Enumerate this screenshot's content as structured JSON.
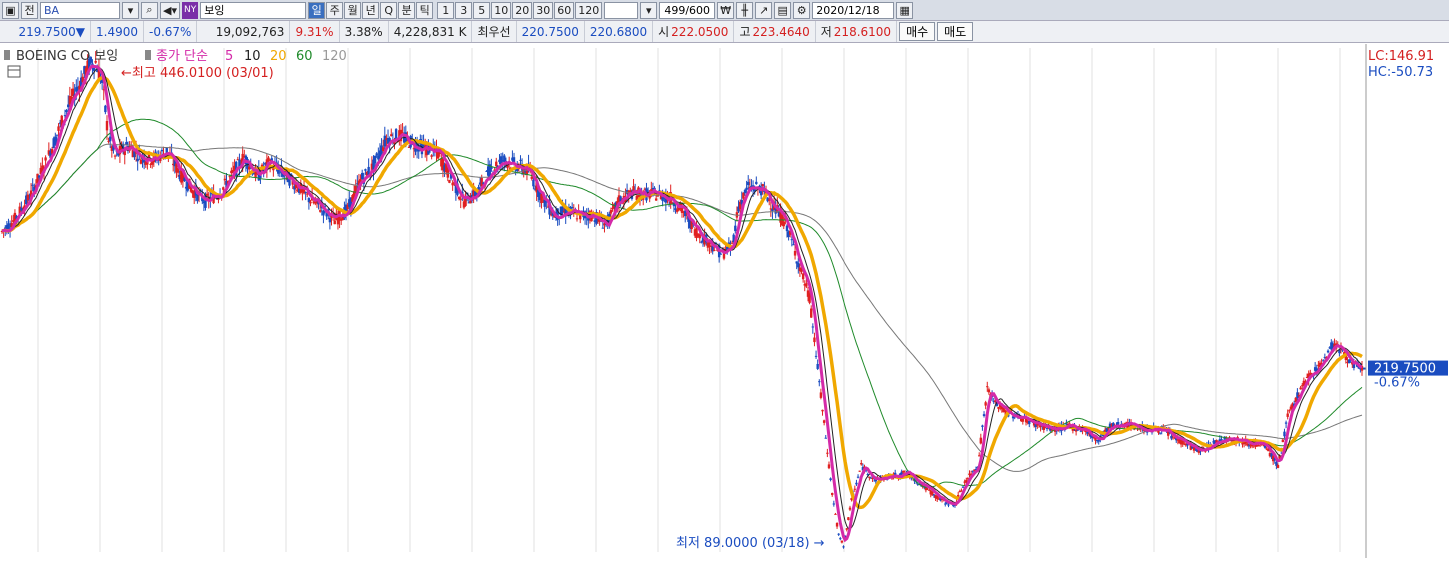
{
  "toolbar": {
    "code": "BA",
    "exchange_badge": "NY",
    "name": "보잉",
    "periods": [
      "일",
      "주",
      "월",
      "년",
      "Q",
      "분",
      "틱"
    ],
    "active_period": "일",
    "minutes": [
      "1",
      "3",
      "5",
      "10",
      "20",
      "30",
      "60",
      "120"
    ],
    "count": "499/600",
    "date": "2020/12/18",
    "label_prev": "전"
  },
  "quote": {
    "price": "219.7500▼",
    "change": "1.4900",
    "change_pct": "-0.67%",
    "volume": "19,092,763",
    "vol_pct": "9.31%",
    "vol_pct2": "3.38%",
    "amount": "4,228,831 K",
    "bid_label": "최우선",
    "bid1": "220.7500",
    "bid2": "220.6800",
    "open_label": "시",
    "open": "222.0500",
    "high_label": "고",
    "high": "223.4640",
    "low_label": "저",
    "low": "218.6100",
    "buy_label": "매수",
    "sell_label": "매도"
  },
  "legend": {
    "name": "BOEING CO  보잉",
    "ma_label": "종가 단순",
    "ma_periods": [
      "5",
      "10",
      "20",
      "60",
      "120"
    ]
  },
  "colors": {
    "up": "#e02020",
    "down": "#1a4cc0",
    "ma5": "#d42aa8",
    "ma10": "#222222",
    "ma20": "#f0a800",
    "ma60": "#1f8a2a",
    "ma120": "#777777",
    "grid": "#d0d0d0",
    "price_tag": "#1a4cc0"
  },
  "chart_data": {
    "type": "candlestick",
    "ylim": [
      88,
      450
    ],
    "yticks": [
      "100,0000",
      "125,0000",
      "150,0000",
      "175,0000",
      "200,0000",
      "225,0000",
      "250,0000",
      "275,0000",
      "300,0000",
      "325,0000",
      "350,0000",
      "375,0000",
      "400,0000",
      "425,0000"
    ],
    "last_price": "219.7500",
    "last_change": "-0.67%",
    "lc": "LC:146.91",
    "hc": "HC:-50.73",
    "high_annotation": "←최고 446.0100 (03/01)",
    "low_annotation": "최저 89.0000 (03/18) →",
    "anchors": [
      [
        0,
        318
      ],
      [
        8,
        327
      ],
      [
        18,
        345
      ],
      [
        28,
        370
      ],
      [
        38,
        400
      ],
      [
        46,
        420
      ],
      [
        54,
        438
      ],
      [
        58,
        440
      ],
      [
        62,
        425
      ],
      [
        66,
        385
      ],
      [
        70,
        372
      ],
      [
        78,
        380
      ],
      [
        86,
        372
      ],
      [
        94,
        370
      ],
      [
        102,
        376
      ],
      [
        110,
        360
      ],
      [
        118,
        348
      ],
      [
        126,
        340
      ],
      [
        134,
        345
      ],
      [
        142,
        358
      ],
      [
        150,
        372
      ],
      [
        158,
        358
      ],
      [
        166,
        368
      ],
      [
        174,
        360
      ],
      [
        182,
        352
      ],
      [
        190,
        342
      ],
      [
        198,
        335
      ],
      [
        206,
        326
      ],
      [
        214,
        334
      ],
      [
        222,
        355
      ],
      [
        230,
        365
      ],
      [
        238,
        385
      ],
      [
        246,
        387
      ],
      [
        254,
        382
      ],
      [
        262,
        378
      ],
      [
        270,
        374
      ],
      [
        278,
        356
      ],
      [
        286,
        340
      ],
      [
        294,
        346
      ],
      [
        302,
        362
      ],
      [
        310,
        370
      ],
      [
        318,
        366
      ],
      [
        326,
        362
      ],
      [
        334,
        343
      ],
      [
        342,
        330
      ],
      [
        350,
        333
      ],
      [
        358,
        330
      ],
      [
        366,
        330
      ],
      [
        374,
        323
      ],
      [
        382,
        340
      ],
      [
        390,
        346
      ],
      [
        398,
        345
      ],
      [
        406,
        345
      ],
      [
        414,
        342
      ],
      [
        422,
        332
      ],
      [
        430,
        318
      ],
      [
        438,
        310
      ],
      [
        446,
        302
      ],
      [
        452,
        308
      ],
      [
        456,
        336
      ],
      [
        462,
        350
      ],
      [
        470,
        349
      ],
      [
        478,
        336
      ],
      [
        486,
        322
      ],
      [
        494,
        292
      ],
      [
        500,
        270
      ],
      [
        506,
        210
      ],
      [
        510,
        170
      ],
      [
        514,
        130
      ],
      [
        518,
        100
      ],
      [
        521,
        92
      ],
      [
        526,
        125
      ],
      [
        532,
        150
      ],
      [
        540,
        140
      ],
      [
        550,
        142
      ],
      [
        560,
        145
      ],
      [
        570,
        136
      ],
      [
        578,
        128
      ],
      [
        584,
        124
      ],
      [
        590,
        122
      ],
      [
        596,
        138
      ],
      [
        604,
        150
      ],
      [
        610,
        205
      ],
      [
        615,
        195
      ],
      [
        622,
        188
      ],
      [
        630,
        185
      ],
      [
        640,
        180
      ],
      [
        650,
        176
      ],
      [
        660,
        178
      ],
      [
        670,
        176
      ],
      [
        678,
        168
      ],
      [
        686,
        178
      ],
      [
        694,
        180
      ],
      [
        702,
        178
      ],
      [
        710,
        176
      ],
      [
        718,
        176
      ],
      [
        726,
        170
      ],
      [
        734,
        165
      ],
      [
        742,
        160
      ],
      [
        750,
        166
      ],
      [
        758,
        170
      ],
      [
        766,
        168
      ],
      [
        774,
        166
      ],
      [
        782,
        164
      ],
      [
        790,
        150
      ],
      [
        796,
        185
      ],
      [
        804,
        205
      ],
      [
        812,
        218
      ],
      [
        818,
        225
      ],
      [
        824,
        238
      ],
      [
        830,
        232
      ],
      [
        836,
        223
      ],
      [
        842,
        220
      ]
    ]
  }
}
